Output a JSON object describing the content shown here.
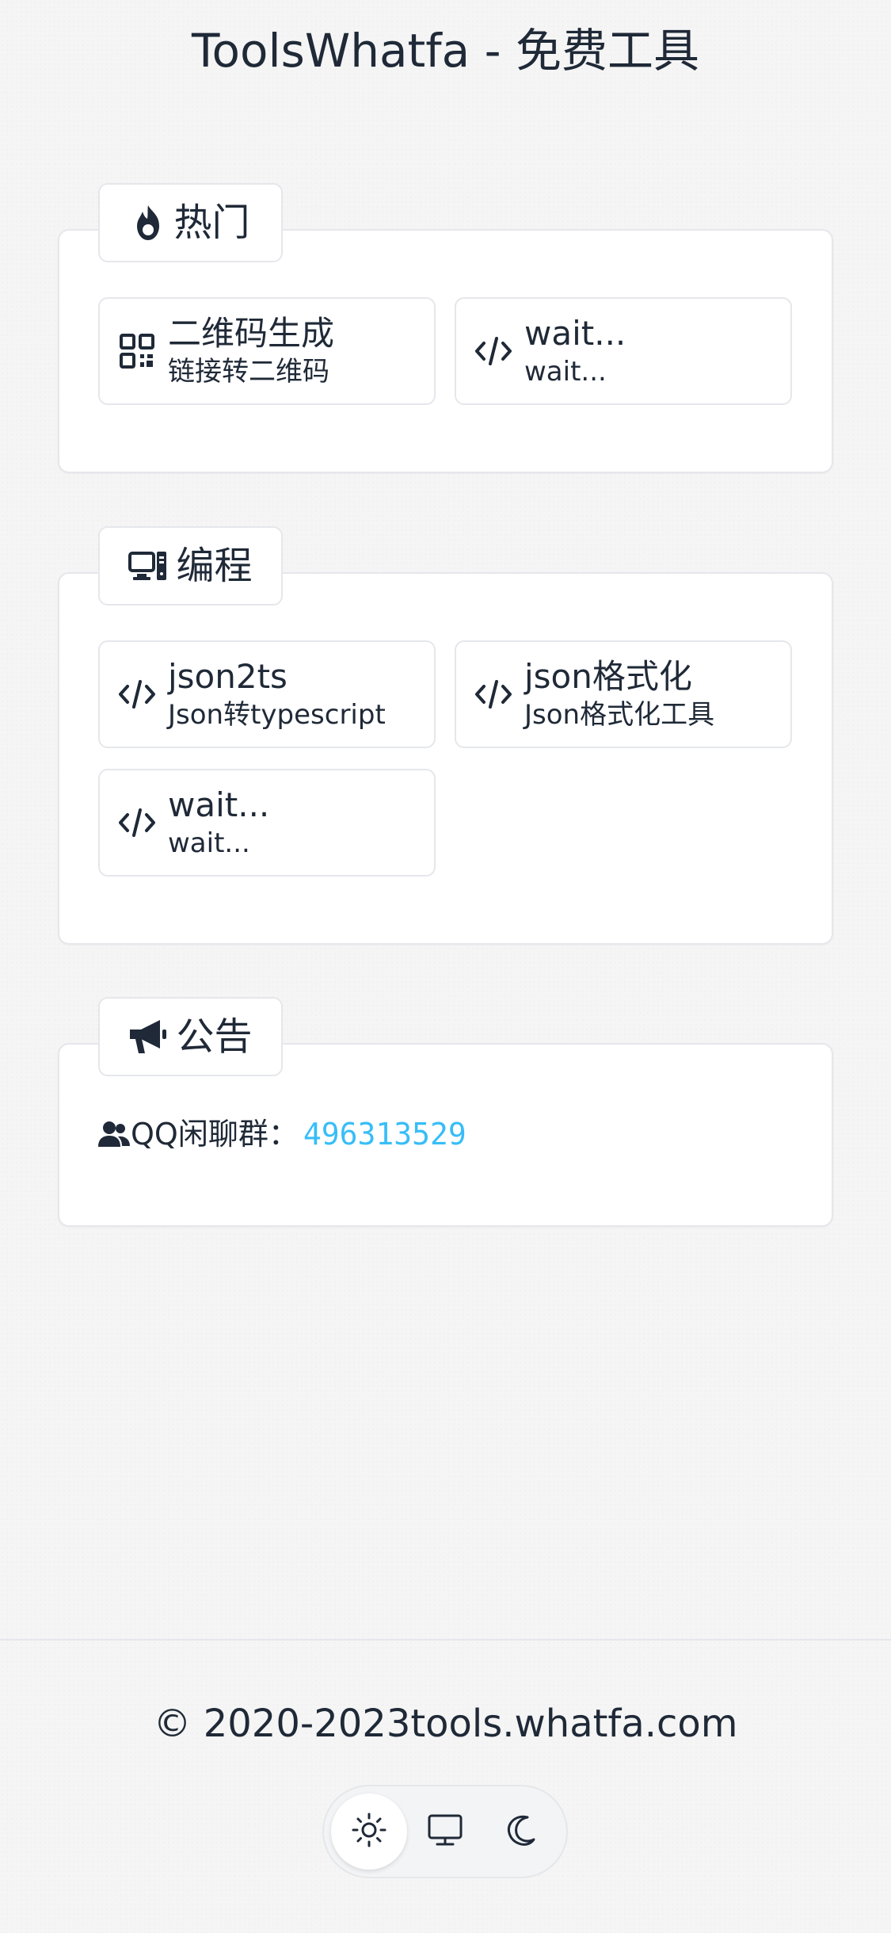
{
  "header": {
    "title": "ToolsWhatfa - 免费工具"
  },
  "sections": [
    {
      "label": "热门",
      "icon": "fire-icon",
      "cards": [
        {
          "title": "二维码生成",
          "subtitle": "链接转二维码",
          "icon": "qrcode-icon"
        },
        {
          "title": "wait...",
          "subtitle": "wait...",
          "icon": "code-icon"
        }
      ]
    },
    {
      "label": "编程",
      "icon": "computer-icon",
      "cards": [
        {
          "title": "json2ts",
          "subtitle": "Json转typescript",
          "icon": "code-icon"
        },
        {
          "title": "json格式化",
          "subtitle": "Json格式化工具",
          "icon": "code-icon"
        },
        {
          "title": "wait...",
          "subtitle": "wait...",
          "icon": "code-icon"
        }
      ]
    },
    {
      "label": "公告",
      "icon": "bullhorn-icon",
      "notice": {
        "icon": "users-icon",
        "label": "QQ闲聊群：",
        "value": "496313529"
      }
    }
  ],
  "footer": {
    "copyright": "© 2020-2023tools.whatfa.com",
    "theme_modes": [
      {
        "name": "light",
        "icon": "sun-icon",
        "active": true
      },
      {
        "name": "system",
        "icon": "monitor-icon",
        "active": false
      },
      {
        "name": "dark",
        "icon": "moon-icon",
        "active": false
      }
    ]
  },
  "colors": {
    "text": "#1f2937",
    "link": "#38bdf8",
    "border": "#e5e7eb",
    "background": "#f5f5f5"
  }
}
